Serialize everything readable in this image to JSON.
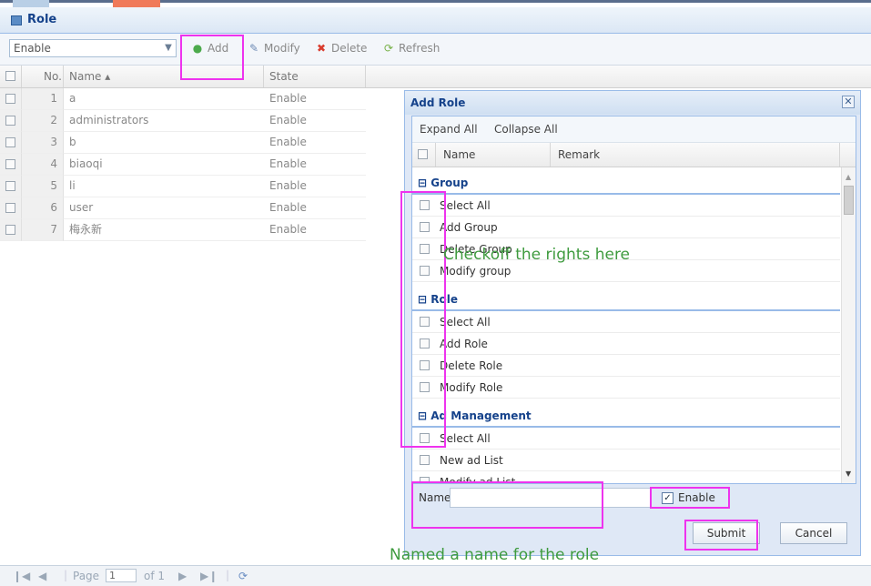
{
  "panel": {
    "title": "Role"
  },
  "toolbar": {
    "filter_value": "Enable",
    "add": "Add",
    "modify": "Modify",
    "delete": "Delete",
    "refresh": "Refresh"
  },
  "grid": {
    "columns": {
      "no": "No.",
      "name": "Name ▴",
      "state": "State"
    },
    "rows": [
      {
        "no": "1",
        "name": "a",
        "state": "Enable"
      },
      {
        "no": "2",
        "name": "administrators",
        "state": "Enable"
      },
      {
        "no": "3",
        "name": "b",
        "state": "Enable"
      },
      {
        "no": "4",
        "name": "biaoqi",
        "state": "Enable"
      },
      {
        "no": "5",
        "name": "li",
        "state": "Enable"
      },
      {
        "no": "6",
        "name": "user",
        "state": "Enable"
      },
      {
        "no": "7",
        "name": "梅永新",
        "state": "Enable"
      }
    ]
  },
  "pager": {
    "page_label": "Page",
    "page_value": "1",
    "of_label": "of 1"
  },
  "dialog": {
    "title": "Add Role",
    "expand_all": "Expand All",
    "collapse_all": "Collapse All",
    "col_name": "Name",
    "col_remark": "Remark",
    "groups": [
      {
        "label": "⊟ Group",
        "items": [
          "Select All",
          "Add Group",
          "Delete Group",
          "Modify group"
        ]
      },
      {
        "label": "⊟ Role",
        "items": [
          "Select All",
          "Add Role",
          "Delete Role",
          "Modify Role"
        ]
      },
      {
        "label": "⊟ Ad Management",
        "items": [
          "Select All",
          "New ad List",
          "Modify ad List"
        ]
      }
    ],
    "name_label": "Name",
    "name_value": "",
    "enable_label": "Enable",
    "enable_checked": true,
    "submit": "Submit",
    "cancel": "Cancel"
  },
  "annotations": {
    "rights": "Checkoff the rights here",
    "name": "Named a name for the role"
  },
  "colors": {
    "highlight": "#ee33ee",
    "annotation": "#3f9b3f",
    "header_blue": "#15428b"
  }
}
